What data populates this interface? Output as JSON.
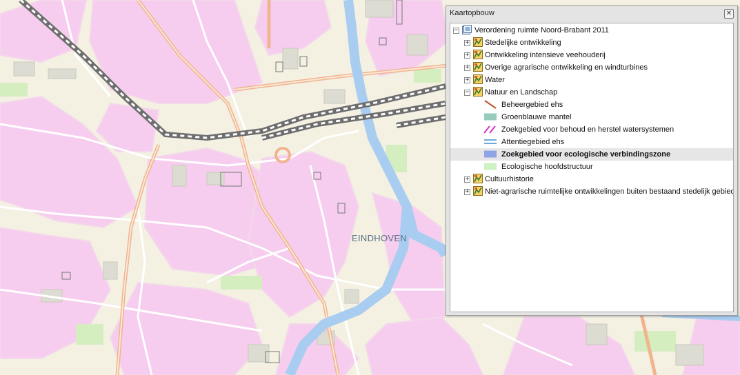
{
  "map": {
    "city_label": "EINDHOVEN"
  },
  "panel": {
    "title": "Kaartopbouw",
    "close_label": "✕",
    "root": {
      "label": "Verordening ruimte Noord-Brabant 2011",
      "icon": "map-service-icon"
    },
    "groups": [
      {
        "label": "Stedelijke ontwikkeling",
        "expanded": false
      },
      {
        "label": "Ontwikkeling intensieve veehouderij",
        "expanded": false
      },
      {
        "label": "Overige agrarische ontwikkeling en windturbines",
        "expanded": false
      },
      {
        "label": "Water",
        "expanded": false
      },
      {
        "label": "Natuur en Landschap",
        "expanded": true
      },
      {
        "label": "Cultuurhistorie",
        "expanded": false
      },
      {
        "label": "Niet-agrarische ruimtelijke ontwikkelingen buiten bestaand stedelijk gebied",
        "expanded": false
      }
    ],
    "legend_items": [
      {
        "label": "Beheergebied ehs",
        "symbol": "line-diagonal",
        "color": "#c0502e"
      },
      {
        "label": "Groenblauwe mantel",
        "symbol": "fill",
        "color": "#96cbbd"
      },
      {
        "label": "Zoekgebied voor behoud en herstel watersystemen",
        "symbol": "line-diagonal-double",
        "color": "#d432c8"
      },
      {
        "label": "Attentiegebied ehs",
        "symbol": "line-horizontal-double",
        "color": "#3a8fd4"
      },
      {
        "label": "Zoekgebied voor ecologische verbindingszone",
        "symbol": "fill",
        "color": "#8fa4e4",
        "selected": true
      },
      {
        "label": "Ecologische hoofdstructuur",
        "symbol": "fill",
        "color": "#cdf2c4"
      }
    ],
    "expand_glyph": "+",
    "collapse_glyph": "−"
  }
}
